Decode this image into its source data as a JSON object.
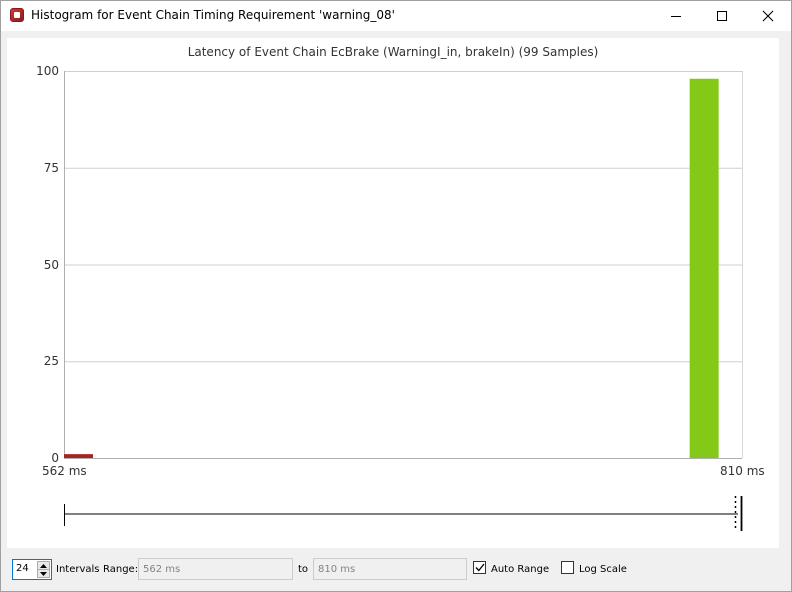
{
  "window": {
    "title": "Histogram for Event Chain Timing Requirement 'warning_08'",
    "icons": {
      "app": "app-icon",
      "minimize": "minimize-icon",
      "maximize": "maximize-icon",
      "close": "close-icon"
    }
  },
  "chart_data": {
    "type": "bar",
    "title": "Latency of Event Chain EcBrake (WarningI_in, brakeIn) (99 Samples)",
    "xlabel": "",
    "ylabel": "",
    "x_range_labels": [
      "562 ms",
      "810 ms"
    ],
    "x_range": [
      562,
      810
    ],
    "ylim": [
      0,
      100
    ],
    "yticks": [
      0,
      25,
      50,
      75,
      100
    ],
    "grid": true,
    "bars": [
      {
        "x": 562,
        "value": 1,
        "color": "#a8251f"
      },
      {
        "x": 800,
        "value": 98,
        "color": "#84c818"
      }
    ],
    "range_slider": {
      "min": 562,
      "max": 810,
      "from": 562,
      "to": 810
    }
  },
  "controls": {
    "intervals_value": "24",
    "intervals_label": "Intervals",
    "range_label": "Range:",
    "range_from": "562 ms",
    "to_label": "to",
    "range_to": "810 ms",
    "auto_range_label": "Auto Range",
    "auto_range_checked": true,
    "log_scale_label": "Log Scale",
    "log_scale_checked": false
  }
}
